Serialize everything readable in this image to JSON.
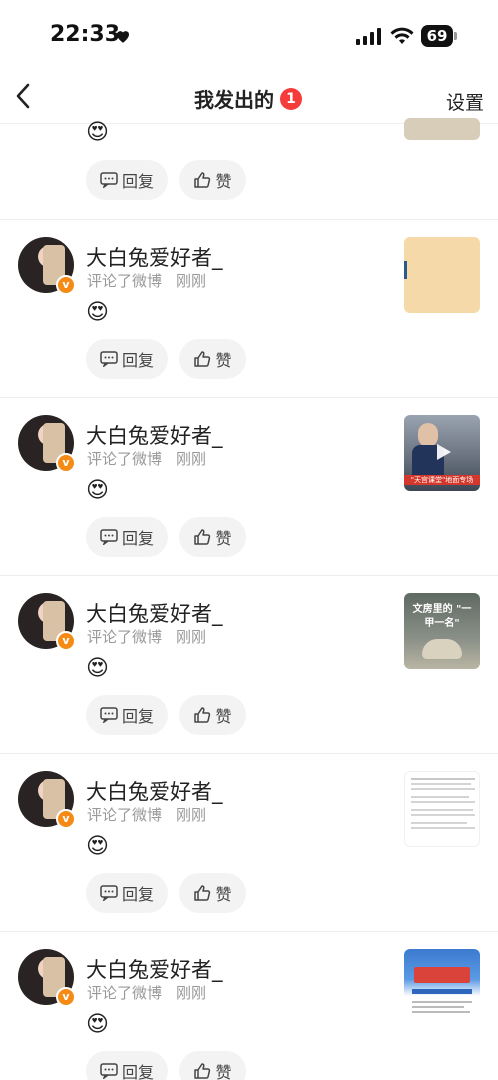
{
  "status": {
    "time": "22:33",
    "battery": "69"
  },
  "nav": {
    "title": "我发出的",
    "badge": "1",
    "settings": "设置"
  },
  "actions": {
    "reply": "回复",
    "like": "赞"
  },
  "items": [
    {
      "username": "大白兔爱好者_",
      "action": "评论了微博",
      "time": "刚刚",
      "emoji": "😍",
      "thumb": "beige"
    },
    {
      "username": "大白兔爱好者_",
      "action": "评论了微博",
      "time": "刚刚",
      "emoji": "😍",
      "thumb": "video",
      "thumb_caption": "\"天宫课堂\"地面专场"
    },
    {
      "username": "大白兔爱好者_",
      "action": "评论了微博",
      "time": "刚刚",
      "emoji": "😍",
      "thumb": "poster",
      "thumb_caption": "文房里的 \"一甲一名\""
    },
    {
      "username": "大白兔爱好者_",
      "action": "评论了微博",
      "time": "刚刚",
      "emoji": "😍",
      "thumb": "document"
    },
    {
      "username": "大白兔爱好者_",
      "action": "评论了微博",
      "time": "刚刚",
      "emoji": "😍",
      "thumb": "banner"
    }
  ],
  "top_partial": {
    "emoji": "😍"
  }
}
